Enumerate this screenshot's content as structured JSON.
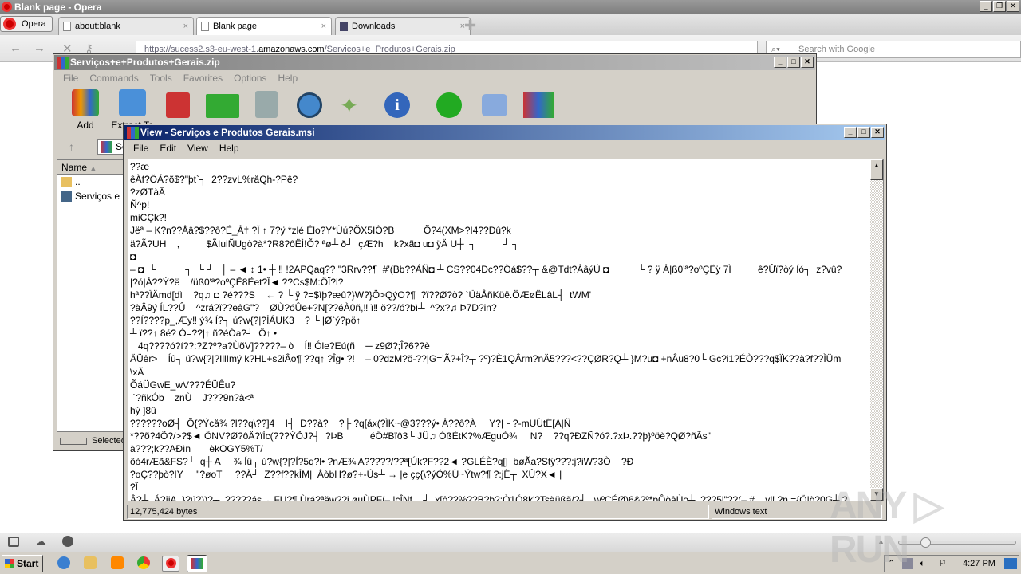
{
  "browser": {
    "title": "Blank page - Opera",
    "menu_label": "Opera",
    "tabs": [
      {
        "label": "about:blank"
      },
      {
        "label": "Blank page",
        "active": true
      },
      {
        "label": "Downloads"
      }
    ],
    "url_prefix": "https://sucess2.s3-eu-west-1.",
    "url_domain": "amazonaws.com",
    "url_path": "/Servicos+e+Produtos+Gerais.zip",
    "search_placeholder": "Search with Google",
    "zoom_level": 0.5
  },
  "winrar": {
    "title": "Serviços+e+Produtos+Gerais.zip",
    "menu": [
      "File",
      "Commands",
      "Tools",
      "Favorites",
      "Options",
      "Help"
    ],
    "toolbar": [
      "Add",
      "Extract To"
    ],
    "path": "Serviços+e+Produtos+Gerais.zip",
    "columns": {
      "name": "Name"
    },
    "files": [
      "..",
      "Serviços e Produtos Gerais.msi"
    ],
    "status": "Selected"
  },
  "viewer": {
    "title": "View - Serviços e Produtos Gerais.msi",
    "menu": [
      "File",
      "Edit",
      "View",
      "Help"
    ],
    "lines": [
      "??æ",
      "êÀf?ÖÁ?õ$?\"þt`┐  2??zvL%råQh-?Pê?",
      "?zØTàÂ",
      "Ñ^p!",
      "miCÇk?!",
      "Jëª – K?n??Åâ?$??ô?É_Â† ?Ï ↑ 7?ÿ *zlé Élo?Y*Ùú?ÕX5IÒ?B           Õ?4(XM>?I4??Ðû?k",
      "ä?Ã?UH    ,          $ÃIuiÑUgò?à*?R8?ôËÌ!Õ? ªø┴ ð┘  çÆ?h    k?xã◘ u◘ ÿÄ U┼  ┐          ┘ ┐",
      "◘",
      "– ◘  └           ┐  └ ┘   │ – ◄ ↕ 1• ┼ ‼ !2APQaq?? \"3Rrv??¶  #'(Bb??ÁÑ◘ ┴ CS??04Dc??Òá$??┬ &@Tdt?ÂâýÚ ◘           └ ? ÿ Â|ß0'ª?oºÇËÿ 7Ì          ê?Ûï?òý Íó┐  z?vû?",
      "|?ó|À??Ý?ë    /üß0'ª?oºÇÊ8Ëet?Î◄ ??Cs$M:ÔÏ?i?",
      "hª??ÏÄmd[dì    ?q♫ ◘ ?é???S    ← ? └ ÿ ?=$ìþ?æû?}W?}Ö>QýO?¶  ?ï??Ø?ò? `ÜäÅñKüë.ÖÆøËLâL┤  tWM'",
      "?àÂ9ý ÍL??Û    ^zrá?ï??eâG\"?    ØÙ?óÛe+?N[??éÀ0ñ,‼ ï‼ ö??/ó?bì┴  ^?x?♫ Þ7D?in?",
      "??Í????p_,Æy‼ ý¾ Í?┐ ú?w{?|?ÎÁUK3    ? └ |Ø`ý?pö↑",
      "┴ ï??↑ 8é? Ó=??|↑ ñ?éÓa?┘  Ô↑ •",
      "   4q????ó?í??:?Z?º?a?ÙõV]?????– ò    Í‼ Óle?Eú(ñ    ┼ z9Ø?;Î?6??è",
      "ÄÜêr>    Íû┐ ú?w{?|?IllImý k?HL+s2iÂo¶ ??q↑ ?Îg• ?!    – 0?dzM?ö-??|G='Ã?+Î?┬ ?º)?È1QÂrm?nÄ5???<??ÇØR?Q┴ }M?u◘ +nÂu8?0└ Gc?i1?ÉÒ???q$ÏK??à?f??ÌÜm",
      "\\xÃ",
      "ÕáÜGwE_wV???ÉÜÊu?",
      " `?ñkÓb    znÙ    J???9n?â<ª",
      "hý ]8û",
      "??????oØ┤  Õ{?Ýcå¾ ?l??q\\??]4    I┤  D??à?    ?├ ?q[áx(?ÌK~@3???ý• Â??ô?À     Y?|├ ?-mUÙtË[A|Ñ",
      "*??õ?4Õ?/>?$◄ ÔNV?Ø?ôÄ?ïÌc(???ÝÕJ?┤  ?ÞB          éÔ#Bïô3└ JÛ♫ ÒßÉtK?%ÆguÒ¾     N?    ??q?ÐZÑ?ó?.?xÞ.??þ}ºöè?QØ?ñÃs\"",
      "à???;k??AÐìn       èkOGY5%T/",
      "ôò4rÆã&FS?┘  q┼ A     ¾ Íû┐ ú?w{?|?Í?5q?l• ?nÆ¾ A?????/??ª[Úk?F??2◄ ?GLÉÈ?q[|  bøÃa?Stÿ???:j?iW?3Ò    ?Ð",
      "?oÇ??þò?IY     \"?øoT     ??À┘  Z??f??kÎM|  ÅòbH?ø?+-Ús┴ → |e çç{\\?ýÓ%Ù~Ýtw?¶ ?:jÈ┬  XÛ?X◄ |",
      "?Î",
      "Â?┴  Á?îjA_}?ú?))?┬  ?????ás→ FU?¶ Ùrá?ªäw??i øuÙPFí– |cÎNf    ┘  x[ô??%??B?þ?;Ò1Ó8k'?Tsàüßã/?┤   wºÇÉØ)6&?º*pÔòâÙo┴  ???5l\"??(– #    y‼ ?n.={Ö|ò?0G┴ ?"
    ],
    "status_size": "12,775,424 bytes",
    "status_encoding": "Windows text"
  },
  "taskbar": {
    "start_label": "Start",
    "clock": "4:27 PM"
  },
  "watermark": "ANY.RUN",
  "colors": {
    "active_title": "#0a246a",
    "inactive_title": "#808080",
    "face": "#d4d0c8"
  }
}
